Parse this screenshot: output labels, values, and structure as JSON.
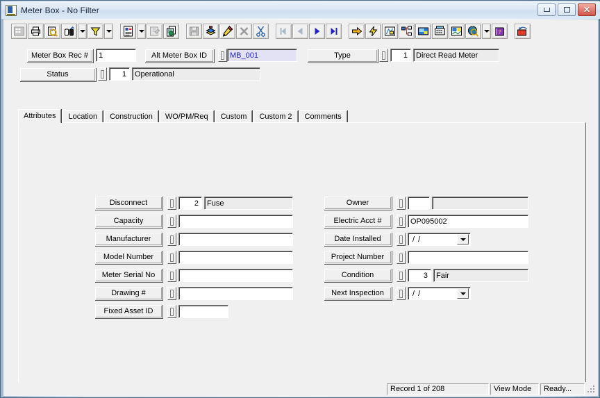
{
  "window": {
    "title": "Meter Box - No Filter",
    "icon": "app-document-icon",
    "controls": {
      "minimize": "minimize-button",
      "maximize": "maximize-button",
      "close": "close-button"
    }
  },
  "toolbar": {
    "groups": [
      {
        "items": [
          {
            "name": "grid-view-icon",
            "disabled": true
          },
          {
            "name": "print-icon",
            "disabled": false
          },
          {
            "name": "print-preview-icon",
            "disabled": false
          },
          {
            "name": "find-binoculars-icon",
            "disabled": false
          },
          {
            "name": "find-dropdown-arrow",
            "dropdown": true
          },
          {
            "name": "filter-funnel-icon",
            "disabled": false
          },
          {
            "name": "filter-dropdown-arrow",
            "dropdown": true
          },
          {
            "name": "report-icon",
            "disabled": false
          },
          {
            "name": "report-dropdown-arrow",
            "dropdown": true
          },
          {
            "name": "properties-icon",
            "disabled": true
          },
          {
            "name": "copy-record-icon",
            "disabled": false
          }
        ]
      },
      {
        "items": [
          {
            "name": "save-icon",
            "disabled": true
          },
          {
            "name": "add-record-icon",
            "disabled": false
          },
          {
            "name": "edit-pencil-icon",
            "disabled": false
          },
          {
            "name": "delete-record-icon",
            "disabled": true
          },
          {
            "name": "cut-scissors-icon",
            "disabled": false
          }
        ]
      },
      {
        "items": [
          {
            "name": "first-record-icon",
            "disabled": true
          },
          {
            "name": "previous-record-icon",
            "disabled": true
          },
          {
            "name": "next-record-icon",
            "disabled": false
          },
          {
            "name": "last-record-icon",
            "disabled": false
          }
        ]
      },
      {
        "items": [
          {
            "name": "goto-arrow-icon",
            "disabled": false
          },
          {
            "name": "lightning-icon",
            "disabled": false
          },
          {
            "name": "map-icon",
            "disabled": false
          },
          {
            "name": "hierarchy-icon",
            "disabled": false
          },
          {
            "name": "image-icon",
            "disabled": false
          },
          {
            "name": "phone-icon",
            "disabled": false
          },
          {
            "name": "chart-icon",
            "disabled": false
          },
          {
            "name": "globe-search-icon",
            "disabled": false
          },
          {
            "name": "globe-dropdown-arrow",
            "dropdown": true
          },
          {
            "name": "help-book-icon",
            "disabled": false
          },
          {
            "name": "exit-icon",
            "disabled": false
          }
        ]
      }
    ]
  },
  "header": {
    "rec_label": "Meter Box Rec #",
    "rec_value": "1",
    "alt_label": "Alt Meter Box ID",
    "alt_value": "MB_001",
    "type_label": "Type",
    "type_code": "1",
    "type_desc": "Direct Read Meter",
    "status_label": "Status",
    "status_code": "1",
    "status_desc": "Operational"
  },
  "tabs": [
    {
      "label": "Attributes",
      "active": true
    },
    {
      "label": "Location",
      "active": false
    },
    {
      "label": "Construction",
      "active": false
    },
    {
      "label": "WO/PM/Req",
      "active": false
    },
    {
      "label": "Custom",
      "active": false
    },
    {
      "label": "Custom 2",
      "active": false
    },
    {
      "label": "Comments",
      "active": false
    }
  ],
  "form": {
    "left": [
      {
        "label": "Disconnect",
        "code": "2",
        "value": "Fuse",
        "kind": "coded"
      },
      {
        "label": "Capacity",
        "code": "",
        "value": "",
        "kind": "text"
      },
      {
        "label": "Manufacturer",
        "code": "",
        "value": "",
        "kind": "text"
      },
      {
        "label": "Model Number",
        "code": "",
        "value": "",
        "kind": "text"
      },
      {
        "label": "Meter Serial No",
        "code": "",
        "value": "",
        "kind": "text"
      },
      {
        "label": "Drawing #",
        "code": "",
        "value": "",
        "kind": "text"
      },
      {
        "label": "Fixed Asset ID",
        "code": "",
        "value": "",
        "kind": "short"
      }
    ],
    "right": [
      {
        "label": "Owner",
        "code": "",
        "value": "",
        "kind": "coded-empty"
      },
      {
        "label": "Electric Acct #",
        "code": "",
        "value": "OP095002",
        "kind": "text"
      },
      {
        "label": "Date Installed",
        "code": "",
        "value": "/  /",
        "kind": "date"
      },
      {
        "label": "Project Number",
        "code": "",
        "value": "",
        "kind": "text"
      },
      {
        "label": "Condition",
        "code": "3",
        "value": "Fair",
        "kind": "coded"
      },
      {
        "label": "Next Inspection",
        "code": "",
        "value": "/  /",
        "kind": "date"
      }
    ]
  },
  "statusbar": {
    "record": "Record 1 of 208",
    "mode": "View Mode",
    "state": "Ready..."
  },
  "colors": {
    "face": "#f0f0f0",
    "key_field_bg": "#e2e2f4",
    "key_field_text": "#2222cc",
    "close_button": "#d2564a"
  }
}
